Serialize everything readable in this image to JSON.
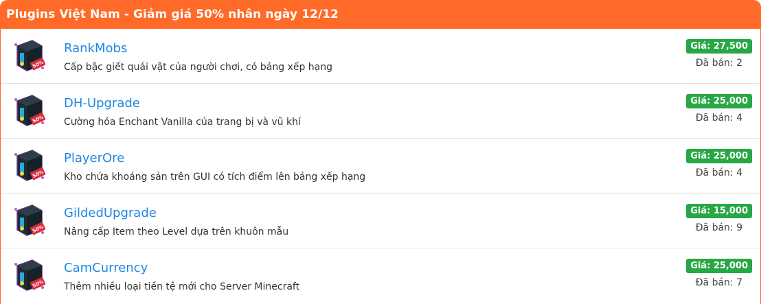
{
  "header": {
    "title": "Plugins Việt Nam - Giảm giá 50% nhân ngày 12/12"
  },
  "colors": {
    "accent": "#ff6a28",
    "link": "#1e88e5",
    "price_badge": "#28a745"
  },
  "items": [
    {
      "name": "RankMobs",
      "description": "Cấp bậc giết quái vật của người chơi, có bảng xếp hạng",
      "price": "Giá: 27,500",
      "sold": "Đã bán: 2",
      "badge": "50%",
      "icon": "plugin-box-icon"
    },
    {
      "name": "DH-Upgrade",
      "description": "Cường hóa Enchant Vanilla của trang bị và vũ khí",
      "price": "Giá: 25,000",
      "sold": "Đã bán: 4",
      "badge": "50%",
      "icon": "plugin-box-icon"
    },
    {
      "name": "PlayerOre",
      "description": "Kho chứa khoáng sản trên GUI có tích điểm lên bảng xếp hạng",
      "price": "Giá: 25,000",
      "sold": "Đã bán: 4",
      "badge": "50%",
      "icon": "plugin-box-icon"
    },
    {
      "name": "GildedUpgrade",
      "description": "Nâng cấp Item theo Level dựa trên khuôn mẫu",
      "price": "Giá: 15,000",
      "sold": "Đã bán: 9",
      "badge": "50%",
      "icon": "plugin-box-icon"
    },
    {
      "name": "CamCurrency",
      "description": "Thêm nhiều loại tiền tệ mới cho Server Minecraft",
      "price": "Giá: 25,000",
      "sold": "Đã bán: 7",
      "badge": "50%",
      "icon": "plugin-box-icon"
    }
  ]
}
